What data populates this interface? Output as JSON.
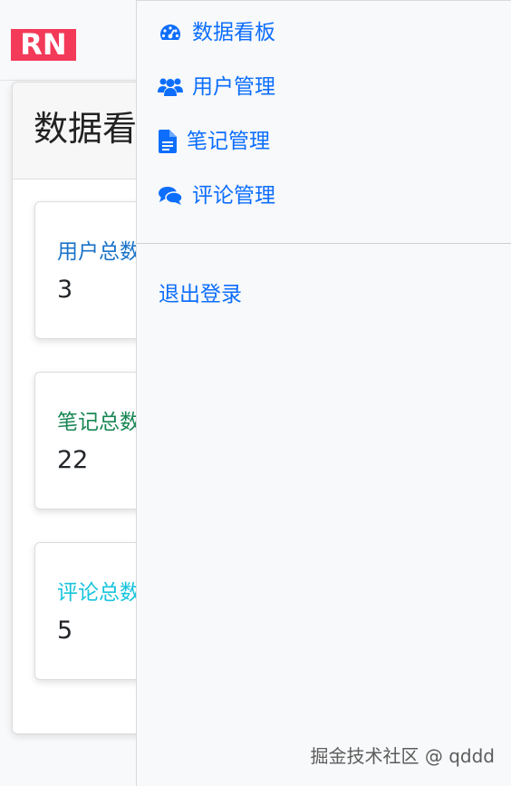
{
  "brand": {
    "logo_text": "RN",
    "logo_color": "#f33a59"
  },
  "main": {
    "title": "数据看板",
    "stats": [
      {
        "label": "用户总数",
        "value": "3",
        "color": "#1a73c8"
      },
      {
        "label": "笔记总数",
        "value": "22",
        "color": "#198754"
      },
      {
        "label": "评论总数",
        "value": "5",
        "color": "#18c4dc"
      }
    ]
  },
  "sidebar": {
    "items": [
      {
        "label": "数据看板",
        "icon": "dashboard-icon"
      },
      {
        "label": "用户管理",
        "icon": "users-icon"
      },
      {
        "label": "笔记管理",
        "icon": "document-icon"
      },
      {
        "label": "评论管理",
        "icon": "comments-icon"
      }
    ],
    "logout_label": "退出登录"
  },
  "watermark": "掘金技术社区 @ qddd",
  "colors": {
    "link": "#0d6efd",
    "panel_bg": "#f8f9fa"
  }
}
